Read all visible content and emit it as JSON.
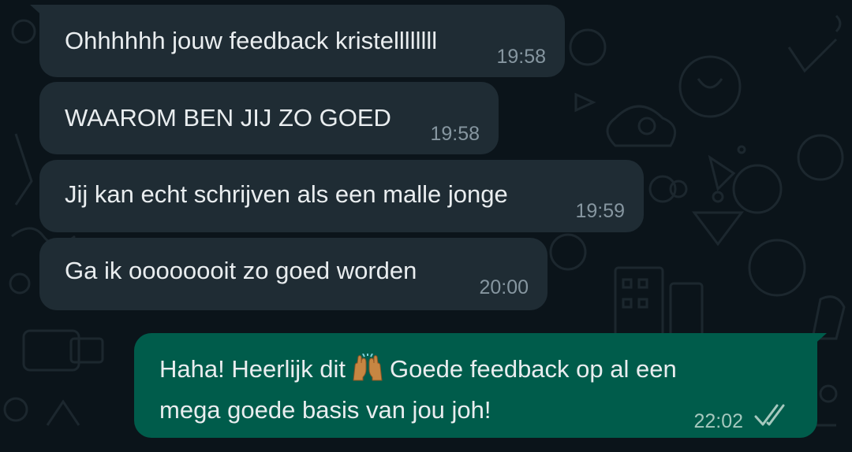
{
  "chat": {
    "messages": [
      {
        "direction": "incoming",
        "text": "Ohhhhhh jouw feedback kristellllllll",
        "time": "19:58"
      },
      {
        "direction": "incoming",
        "text": "WAAROM BEN JIJ ZO GOED",
        "time": "19:58"
      },
      {
        "direction": "incoming",
        "text": "Jij kan echt schrijven als een malle jonge",
        "time": "19:59"
      },
      {
        "direction": "incoming",
        "text": "Ga ik oooooooit zo goed worden",
        "time": "20:00"
      },
      {
        "direction": "outgoing",
        "text_line1_before_emoji": "Haha! Heerlijk dit",
        "emoji": "raising-hands",
        "text_line1_after_emoji": "Goede feedback op al een",
        "text_line2": "mega goede basis van jou joh!",
        "time": "22:02",
        "status": "read"
      }
    ]
  },
  "colors": {
    "background": "#0b141a",
    "incoming_bubble": "#1f2c34",
    "outgoing_bubble": "#005c4b",
    "text": "#e9edef",
    "timestamp": "#8696a0"
  }
}
